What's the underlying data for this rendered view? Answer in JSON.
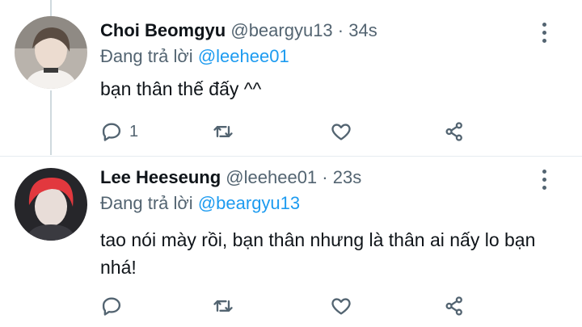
{
  "tweets": [
    {
      "name": "Choi Beomgyu",
      "handle": "@beargyu13",
      "time": "· 34s",
      "reply_prefix": "Đang trả lời",
      "reply_to": "@leehee01",
      "text": "bạn thân thế đấy ^^",
      "reply_count": "1"
    },
    {
      "name": "Lee Heeseung",
      "handle": "@leehee01",
      "time": "· 23s",
      "reply_prefix": "Đang trả lời",
      "reply_to": "@beargyu13",
      "text": "tao nói mày rồi, bạn thân nhưng là thân ai nấy lo bạn nhá!",
      "reply_count": ""
    }
  ],
  "icons": {
    "reply": "reply-icon",
    "retweet": "retweet-icon",
    "like": "heart-icon",
    "share": "share-icon",
    "more": "more-vertical-icon"
  },
  "colors": {
    "mention": "#1d9bf0",
    "muted": "#536471",
    "text": "#0f1419"
  }
}
